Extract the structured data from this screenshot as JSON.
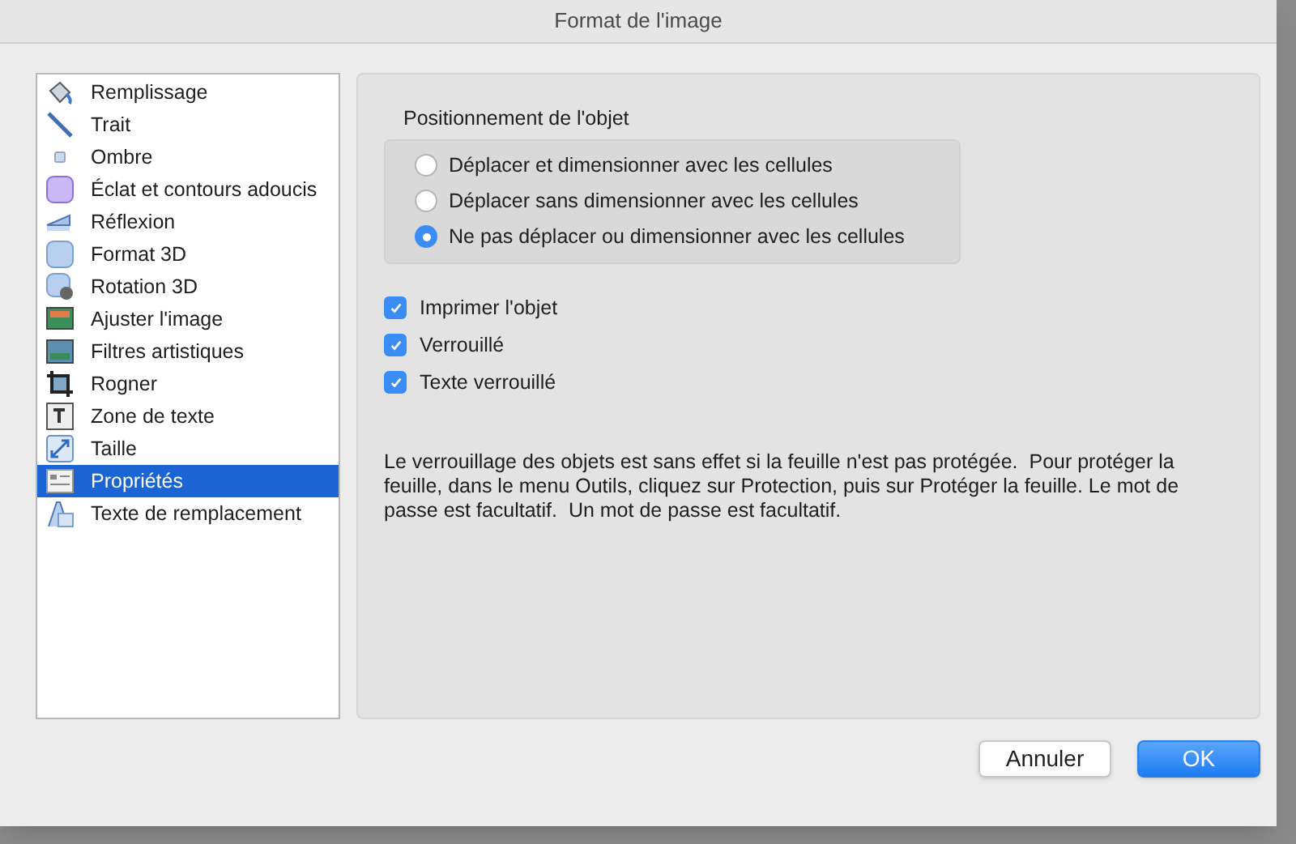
{
  "window": {
    "title": "Format de l'image"
  },
  "sidebar": {
    "items": [
      {
        "label": "Remplissage",
        "selected": false
      },
      {
        "label": "Trait",
        "selected": false
      },
      {
        "label": "Ombre",
        "selected": false
      },
      {
        "label": "Éclat et contours adoucis",
        "selected": false
      },
      {
        "label": "Réflexion",
        "selected": false
      },
      {
        "label": "Format 3D",
        "selected": false
      },
      {
        "label": "Rotation 3D",
        "selected": false
      },
      {
        "label": "Ajuster l'image",
        "selected": false
      },
      {
        "label": "Filtres artistiques",
        "selected": false
      },
      {
        "label": "Rogner",
        "selected": false
      },
      {
        "label": "Zone de texte",
        "selected": false
      },
      {
        "label": "Taille",
        "selected": false
      },
      {
        "label": "Propriétés",
        "selected": true
      },
      {
        "label": "Texte de remplacement",
        "selected": false
      }
    ]
  },
  "positioning": {
    "title": "Positionnement de l'objet",
    "options": [
      {
        "label": "Déplacer et dimensionner avec les cellules",
        "selected": false
      },
      {
        "label": "Déplacer sans dimensionner avec les cellules",
        "selected": false
      },
      {
        "label": "Ne pas déplacer ou dimensionner avec les cellules",
        "selected": true
      }
    ]
  },
  "checkboxes": [
    {
      "label": "Imprimer l'objet",
      "checked": true
    },
    {
      "label": "Verrouillé",
      "checked": true
    },
    {
      "label": "Texte verrouillé",
      "checked": true
    }
  ],
  "note": "Le verrouillage des objets est sans effet si la feuille n'est pas protégée.  Pour protéger la feuille, dans le menu Outils, cliquez sur Protection, puis sur Protéger la feuille. Le mot de passe est facultatif.  Un mot de passe est facultatif.",
  "buttons": [
    {
      "label": "Annuler",
      "kind": "secondary"
    },
    {
      "label": "OK",
      "kind": "primary"
    }
  ]
}
